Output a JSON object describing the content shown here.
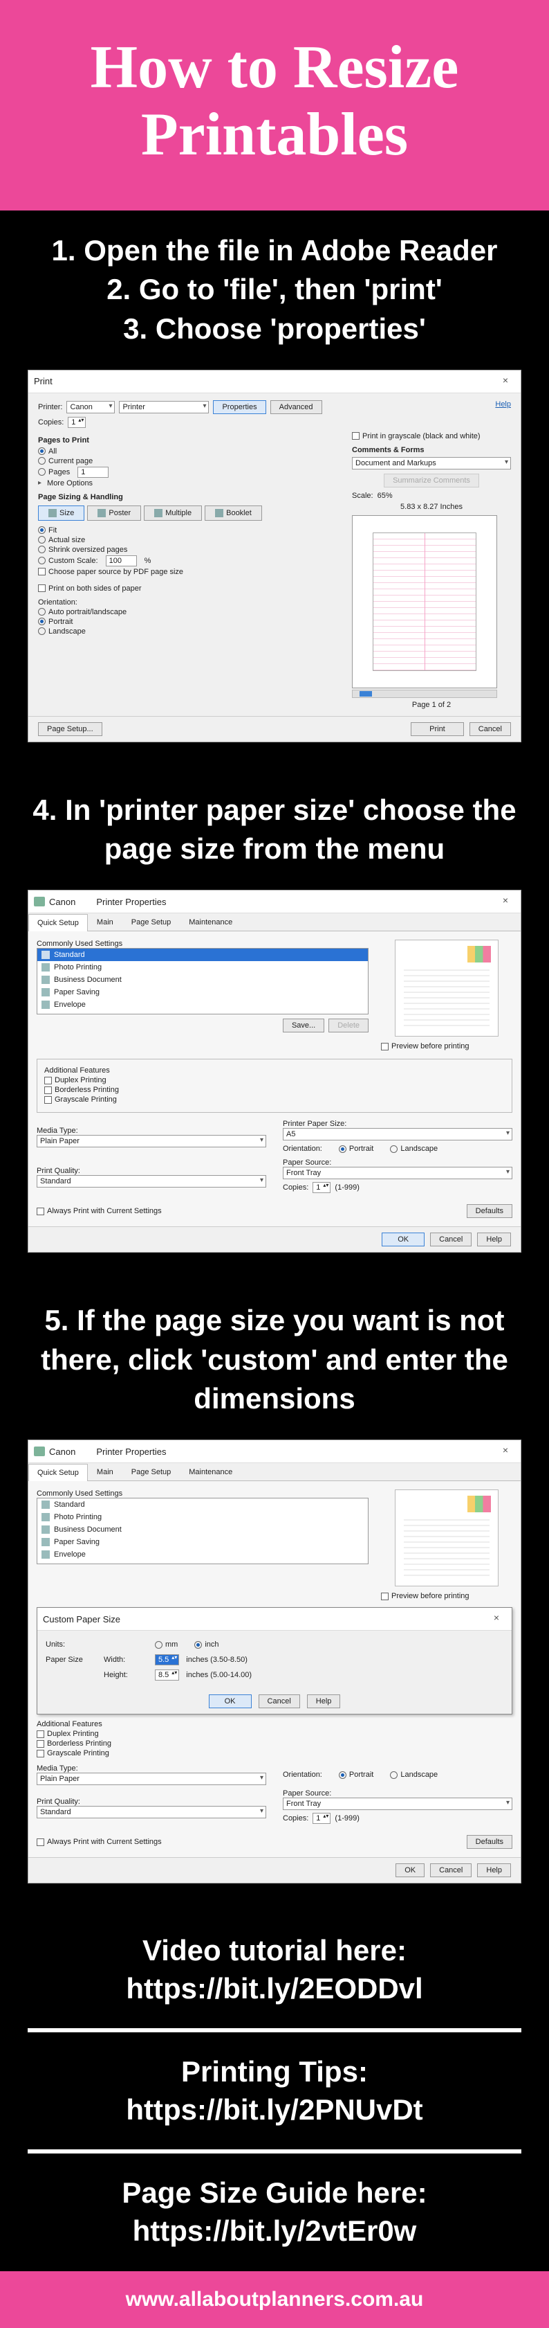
{
  "hero": {
    "title": "How to Resize Printables"
  },
  "step1": "1. Open the file in Adobe Reader",
  "step2": "2. Go to 'file', then 'print'",
  "step3": "3. Choose 'properties'",
  "step4": "4. In 'printer paper size' choose the page size from the menu",
  "step5": "5. If the page size you want is not there, click 'custom' and enter the dimensions",
  "printDlg": {
    "title": "Print",
    "help": "Help",
    "printerLabel": "Printer:",
    "printerBrand": "Canon",
    "printerModel": "Printer",
    "copiesLabel": "Copies:",
    "copiesVal": "1",
    "props": "Properties",
    "advanced": "Advanced",
    "gray": "Print in grayscale (black and white)",
    "pagesTitle": "Pages to Print",
    "all": "All",
    "current": "Current page",
    "pages": "Pages",
    "pagesVal": "1",
    "more": "More Options",
    "sizingTitle": "Page Sizing & Handling",
    "tabSize": "Size",
    "tabPoster": "Poster",
    "tabMultiple": "Multiple",
    "tabBooklet": "Booklet",
    "fit": "Fit",
    "actual": "Actual size",
    "shrink": "Shrink oversized pages",
    "customScale": "Custom Scale:",
    "customScaleVal": "100",
    "percent": "%",
    "pdfSize": "Choose paper source by PDF page size",
    "both": "Print on both sides of paper",
    "orientTitle": "Orientation:",
    "auto": "Auto portrait/landscape",
    "portrait": "Portrait",
    "landscape": "Landscape",
    "commentsTitle": "Comments & Forms",
    "commentsVal": "Document and Markups",
    "summarize": "Summarize Comments",
    "scaleLabel": "Scale:",
    "scaleVal": "65%",
    "dimLabel": "5.83 x 8.27 Inches",
    "pageN": "Page 1 of 2",
    "setup": "Page Setup...",
    "print": "Print",
    "cancel": "Cancel"
  },
  "ppDlg": {
    "brand": "Canon",
    "title": "Printer Properties",
    "tabs": {
      "quick": "Quick Setup",
      "main": "Main",
      "page": "Page Setup",
      "maint": "Maintenance"
    },
    "cus": "Commonly Used Settings",
    "items": {
      "standard": "Standard",
      "photo": "Photo Printing",
      "business": "Business Document",
      "paper": "Paper Saving",
      "envelope": "Envelope"
    },
    "save": "Save...",
    "delete": "Delete",
    "preview": "Preview before printing",
    "addl": "Additional Features",
    "duplex": "Duplex Printing",
    "borderless": "Borderless Printing",
    "grayscale": "Grayscale Printing",
    "mediaType": "Media Type:",
    "mediaVal": "Plain Paper",
    "quality": "Print Quality:",
    "qualityVal": "Standard",
    "paperSize": "Printer Paper Size:",
    "paperVal": "A5",
    "orientLabel": "Orientation:",
    "portrait": "Portrait",
    "landscape": "Landscape",
    "source": "Paper Source:",
    "sourceVal": "Front Tray",
    "copies": "Copies:",
    "copiesVal": "1",
    "copiesRange": "(1-999)",
    "always": "Always Print with Current Settings",
    "defaults": "Defaults",
    "ok": "OK",
    "cancel": "Cancel",
    "help": "Help"
  },
  "customDlg": {
    "title": "Custom Paper Size",
    "units": "Units:",
    "mm": "mm",
    "inch": "inch",
    "paperSize": "Paper Size",
    "width": "Width:",
    "widthVal": "5.5",
    "widthRange": "inches (3.50-8.50)",
    "height": "Height:",
    "heightVal": "8.5",
    "heightRange": "inches (5.00-14.00)",
    "ok": "OK",
    "cancel": "Cancel",
    "help": "Help"
  },
  "links": {
    "video1": "Video tutorial here:",
    "video2": "https://bit.ly/2EODDvl",
    "tips1": "Printing Tips:",
    "tips2": "https://bit.ly/2PNUvDt",
    "guide1": "Page Size Guide here:",
    "guide2": "https://bit.ly/2vtEr0w"
  },
  "footer": "www.allaboutplanners.com.au"
}
